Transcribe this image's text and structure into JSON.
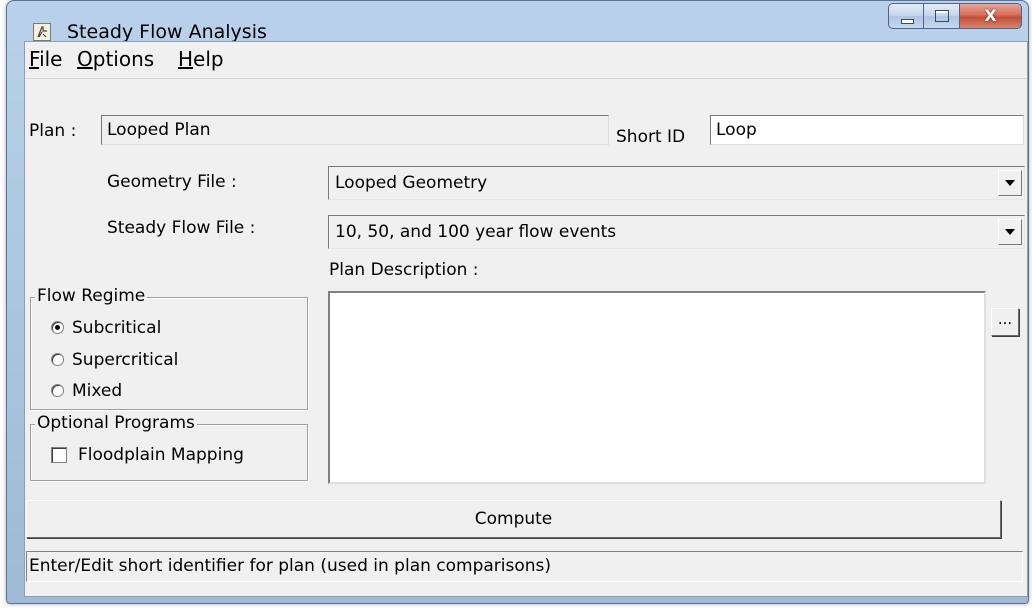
{
  "window": {
    "title": "Steady Flow Analysis",
    "close_glyph": "X"
  },
  "menu": {
    "file": {
      "label": "File",
      "accel": "F",
      "rest": "ile"
    },
    "options": {
      "label": "Options",
      "accel": "O",
      "rest": "ptions"
    },
    "help": {
      "label": "Help",
      "accel": "H",
      "rest": "elp"
    }
  },
  "plan": {
    "label": "Plan :",
    "value": "Looped Plan",
    "short_id_label": "Short ID",
    "short_id_value": "Loop"
  },
  "geometry": {
    "label": "Geometry File :",
    "selected": "Looped Geometry"
  },
  "steady_flow": {
    "label": "Steady Flow File :",
    "selected": "10, 50, and 100 year flow events"
  },
  "description": {
    "label": "Plan Description :",
    "value": "",
    "more_button": "..."
  },
  "flow_regime": {
    "title": "Flow Regime",
    "options": [
      {
        "label": "Subcritical",
        "selected": true
      },
      {
        "label": "Supercritical",
        "selected": false
      },
      {
        "label": "Mixed",
        "selected": false
      }
    ]
  },
  "optional_programs": {
    "title": "Optional Programs",
    "floodplain_mapping": {
      "label": "Floodplain Mapping",
      "checked": false
    }
  },
  "compute_button": "Compute",
  "status_text": "Enter/Edit short identifier for plan (used in plan comparisons)"
}
